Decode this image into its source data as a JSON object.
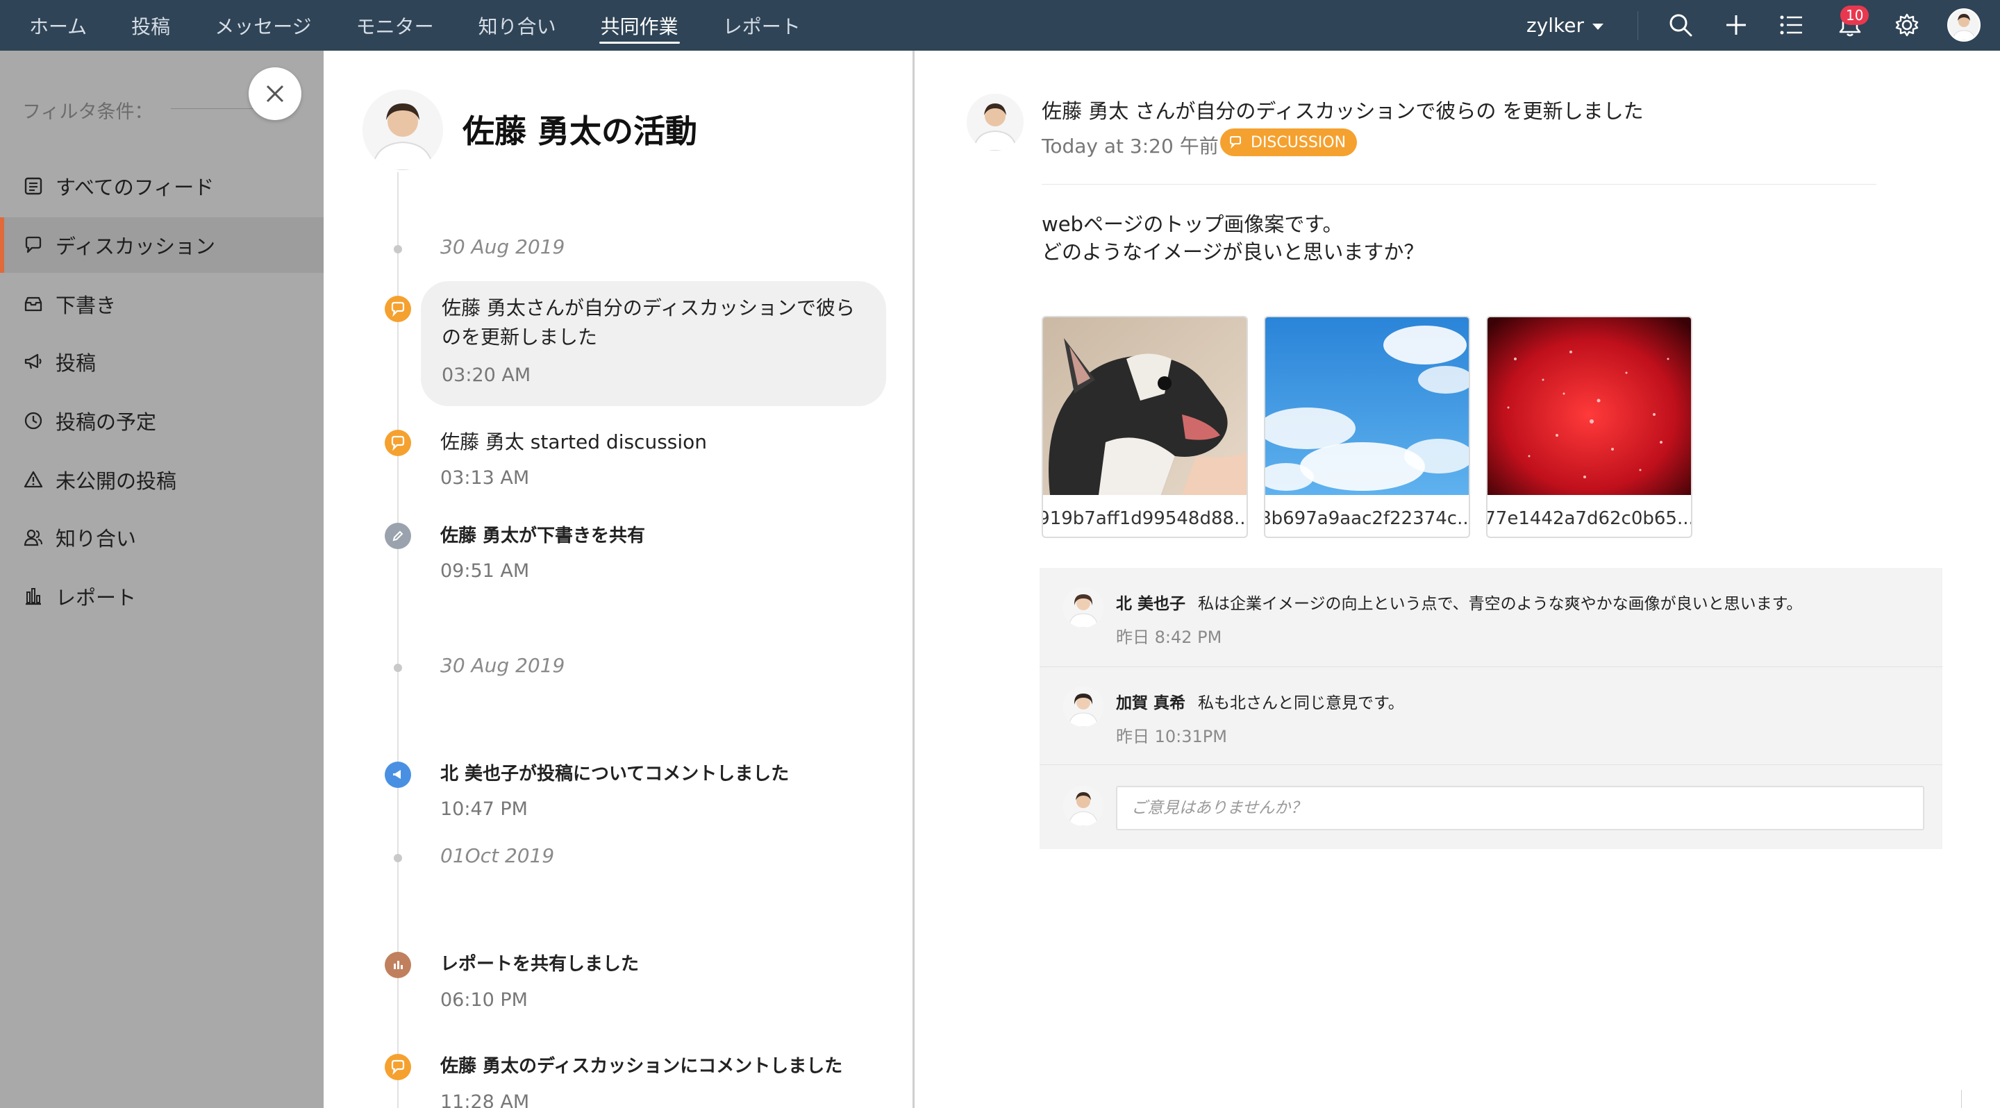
{
  "topnav": {
    "items": [
      "ホーム",
      "投稿",
      "メッセージ",
      "モニター",
      "知り合い",
      "共同作業",
      "レポート"
    ],
    "active_index": 5,
    "org_name": "zylker",
    "notification_count": "10"
  },
  "sidebar": {
    "filter_label": "フィルタ条件：",
    "items": [
      {
        "label": "すべてのフィード",
        "icon": "feed-icon"
      },
      {
        "label": "ディスカッション",
        "icon": "discussion-icon"
      },
      {
        "label": "下書き",
        "icon": "drafts-icon"
      },
      {
        "label": "投稿",
        "icon": "megaphone-icon"
      },
      {
        "label": "投稿の予定",
        "icon": "clock-icon"
      },
      {
        "label": "未公開の投稿",
        "icon": "warning-icon"
      },
      {
        "label": "知り合い",
        "icon": "people-icon"
      },
      {
        "label": "レポート",
        "icon": "report-icon"
      }
    ],
    "active_index": 1
  },
  "activity": {
    "title": "佐藤 勇太の活動",
    "groups": [
      {
        "date": "30 Aug 2019"
      },
      {
        "date": "30 Aug 2019"
      },
      {
        "date": "01Oct 2019"
      }
    ],
    "entries": [
      {
        "text": "佐藤 勇太さんが自分のディスカッションで彼らのを更新しました",
        "time": "03:20 AM",
        "type": "discussion",
        "color": "#f5a12f"
      },
      {
        "text": "佐藤 勇太 started discussion",
        "time": "03:13 AM",
        "type": "discussion",
        "color": "#f5a12f"
      },
      {
        "text": "佐藤 勇太が下書きを共有",
        "time": "09:51 AM",
        "type": "draft",
        "color": "#9aa3ad"
      },
      {
        "text": "北 美也子が投稿についてコメントしました",
        "time": "10:47 PM",
        "type": "post",
        "color": "#4a90e2"
      },
      {
        "text": "レポートを共有しました",
        "time": "06:10 PM",
        "type": "report",
        "color": "#c0805e"
      },
      {
        "text": "佐藤 勇太のディスカッションにコメントしました",
        "time": "11:28 AM",
        "type": "discussion",
        "color": "#f5a12f"
      }
    ]
  },
  "post": {
    "headline": "佐藤 勇太 さんが自分のディスカッションで彼らの を更新しました",
    "date": "Today at 3:20 午前",
    "tag": "DISCUSSION",
    "body_line1": "webページのトップ画像案です。",
    "body_line2": "どのようなイメージが良いと思いますか？",
    "attachments": [
      {
        "name": "919b7aff1d99548d88...",
        "subject": "dog photo"
      },
      {
        "name": "8b697a9aac2f22374c...",
        "subject": "blue sky photo"
      },
      {
        "name": "77e1442a7d62c0b65...",
        "subject": "red sparkle photo"
      }
    ],
    "comments": [
      {
        "name": "北 美也子",
        "text": "私は企業イメージの向上という点で、青空のような爽やかな画像が良いと思います。",
        "time": "昨日 8:42 PM"
      },
      {
        "name": "加賀 真希",
        "text": "私も北さんと同じ意見です。",
        "time": "昨日 10:31PM"
      }
    ],
    "reply_placeholder": "ご意見はありませんか？"
  },
  "colors": {
    "topbar": "#2f4456",
    "sidebar": "#a9a9a9",
    "accent": "#f5a12f",
    "active_marker": "#e06a3a",
    "badge": "#e8384f"
  }
}
